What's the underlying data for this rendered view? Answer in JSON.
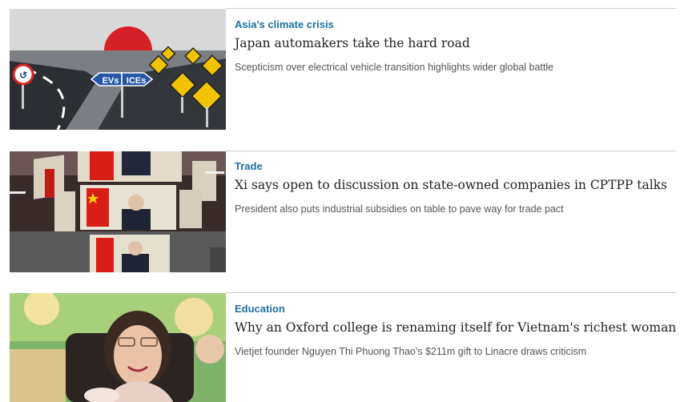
{
  "articles": [
    {
      "tag": "Asia's climate crisis",
      "headline": "Japan automakers take the hard road",
      "standfirst": "Scepticism over electrical vehicle transition highlights wider global battle",
      "image_labels": [
        "EVs",
        "ICEs"
      ],
      "image_icons": [
        "rising-sun",
        "winding-road",
        "road-signs"
      ]
    },
    {
      "tag": "Trade",
      "headline": "Xi says open to discussion on state-owned companies in CPTPP talks",
      "standfirst": "President also puts industrial subsidies on table to pave way for trade pact",
      "image_icons": [
        "video-screens",
        "flags"
      ]
    },
    {
      "tag": "Education",
      "headline": "Why an Oxford college is renaming itself for Vietnam's richest woman",
      "standfirst": "Vietjet founder Nguyen Thi Phuong Thao's $211m gift to Linacre draws criticism",
      "image_icons": [
        "portrait-photo"
      ]
    }
  ],
  "colors": {
    "tag": "#1f6fa3",
    "headline": "#222222",
    "standfirst": "#555555",
    "divider": "#cccccc"
  }
}
